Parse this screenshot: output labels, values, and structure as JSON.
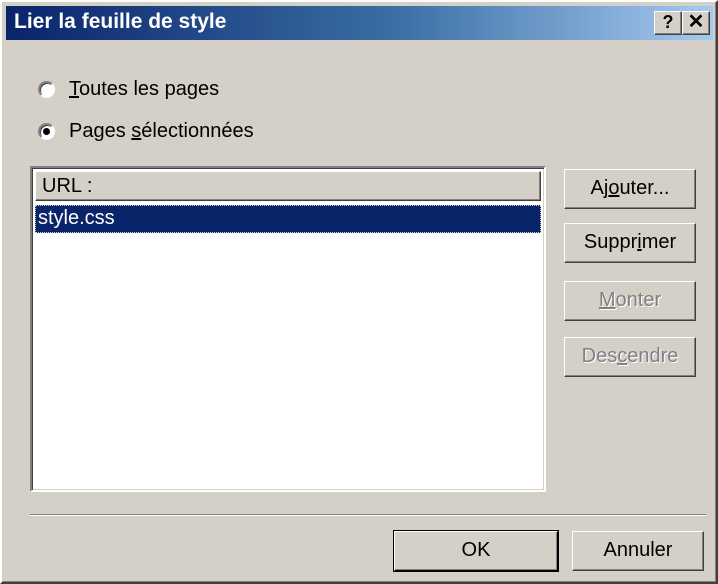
{
  "window": {
    "title": "Lier la feuille de style",
    "help_button": "?",
    "close_button": "✕"
  },
  "scope": {
    "option_all": {
      "pre": "",
      "mnemonic": "T",
      "post": "outes les pages",
      "checked": false
    },
    "option_selected": {
      "pre": "Pages ",
      "mnemonic": "s",
      "post": "électionnées",
      "checked": true
    }
  },
  "url_list": {
    "header": "URL :",
    "items": [
      "style.css"
    ],
    "selected_index": 0
  },
  "side_buttons": {
    "add": {
      "pre": "Aj",
      "mnemonic": "o",
      "post": "uter...",
      "enabled": true
    },
    "remove": {
      "pre": "Suppr",
      "mnemonic": "i",
      "post": "mer",
      "enabled": true
    },
    "up": {
      "pre": "",
      "mnemonic": "M",
      "post": "onter",
      "enabled": false
    },
    "down": {
      "pre": "Des",
      "mnemonic": "c",
      "post": "endre",
      "enabled": false
    }
  },
  "footer": {
    "ok_label": "OK",
    "cancel_label": "Annuler"
  },
  "colors": {
    "face": "#d4d0c8",
    "titlebar_start": "#0a246a",
    "titlebar_end": "#a6caf0",
    "selection": "#0a246a"
  }
}
